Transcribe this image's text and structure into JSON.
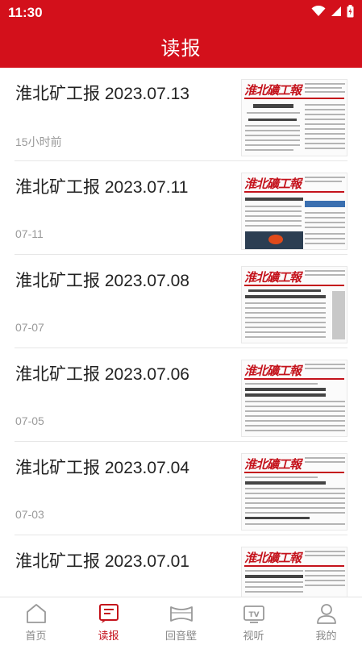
{
  "status_bar": {
    "time": "11:30"
  },
  "header": {
    "title": "读报"
  },
  "newspapers": [
    {
      "title": "淮北矿工报 2023.07.13",
      "date": "15小时前",
      "masthead": "淮北礦工報"
    },
    {
      "title": "淮北矿工报 2023.07.11",
      "date": "07-11",
      "masthead": "淮北礦工報"
    },
    {
      "title": "淮北矿工报 2023.07.08",
      "date": "07-07",
      "masthead": "淮北礦工報"
    },
    {
      "title": "淮北矿工报 2023.07.06",
      "date": "07-05",
      "masthead": "淮北礦工報"
    },
    {
      "title": "淮北矿工报 2023.07.04",
      "date": "07-03",
      "masthead": "淮北礦工報"
    },
    {
      "title": "淮北矿工报 2023.07.01",
      "date": "",
      "masthead": "淮北礦工報"
    }
  ],
  "tabbar": {
    "items": [
      {
        "label": "首页",
        "icon": "home-icon"
      },
      {
        "label": "读报",
        "icon": "newspaper-icon",
        "active": true
      },
      {
        "label": "回音壁",
        "icon": "wall-icon"
      },
      {
        "label": "视听",
        "icon": "tv-icon"
      },
      {
        "label": "我的",
        "icon": "profile-icon"
      }
    ]
  },
  "colors": {
    "brand_red": "#d3101b",
    "active_tab": "#c4121b"
  }
}
